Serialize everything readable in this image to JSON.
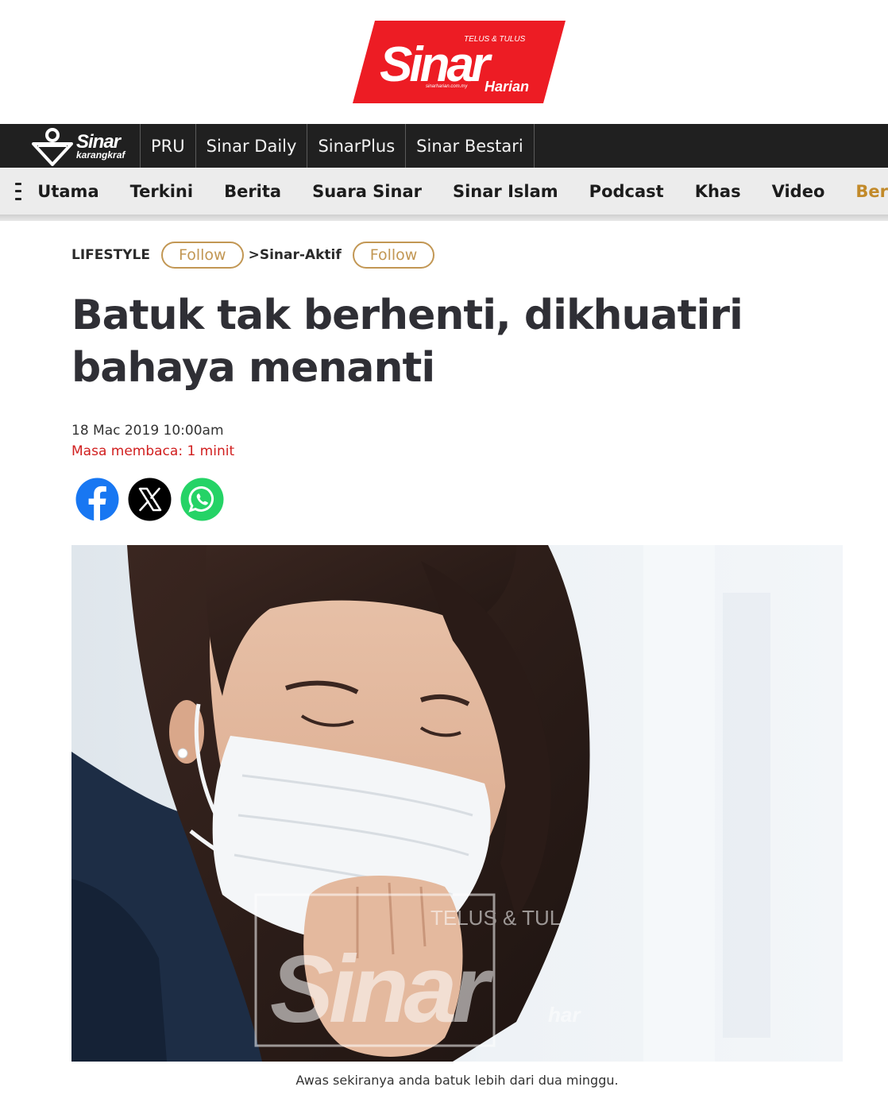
{
  "masthead": {
    "logo_name": "Sinar",
    "logo_sub": "Harian",
    "logo_tagline": "TELUS & TULUS",
    "logo_url_text": "sinarharian.com.my"
  },
  "brand_bar": {
    "logo_main": "Sinar",
    "logo_sub": "karangkraf",
    "items": [
      {
        "label": "PRU"
      },
      {
        "label": "Sinar Daily"
      },
      {
        "label": "SinarPlus"
      },
      {
        "label": "Sinar Bestari"
      }
    ]
  },
  "main_nav": {
    "items": [
      {
        "label": "Utama"
      },
      {
        "label": "Terkini"
      },
      {
        "label": "Berita"
      },
      {
        "label": "Suara Sinar"
      },
      {
        "label": "Sinar Islam"
      },
      {
        "label": "Podcast"
      },
      {
        "label": "Khas"
      },
      {
        "label": "Video"
      },
      {
        "label": "Ber"
      }
    ]
  },
  "article": {
    "category": "LIFESTYLE",
    "follow_label": "Follow",
    "subcategory": ">Sinar-Aktif",
    "subcategory_follow_label": "Follow",
    "title": "Batuk tak berhenti, dikhuatiri bahaya menanti",
    "date": "18 Mac 2019 10:00am",
    "reading_time": "Masa membaca: 1 minit",
    "share": [
      {
        "icon": "facebook-icon",
        "color": "#1877f2"
      },
      {
        "icon": "x-icon",
        "color": "#000000"
      },
      {
        "icon": "whatsapp-icon",
        "color": "#25d366"
      }
    ],
    "image_watermark_line1": "TELUS & TUL",
    "image_watermark_line2": "Sinar",
    "image_watermark_line3": "har",
    "caption": "Awas sekiranya anda batuk lebih dari dua minggu."
  },
  "colors": {
    "brand_red": "#ed1c24",
    "accent_gold": "#c29754",
    "read_time_red": "#d11f1f"
  }
}
